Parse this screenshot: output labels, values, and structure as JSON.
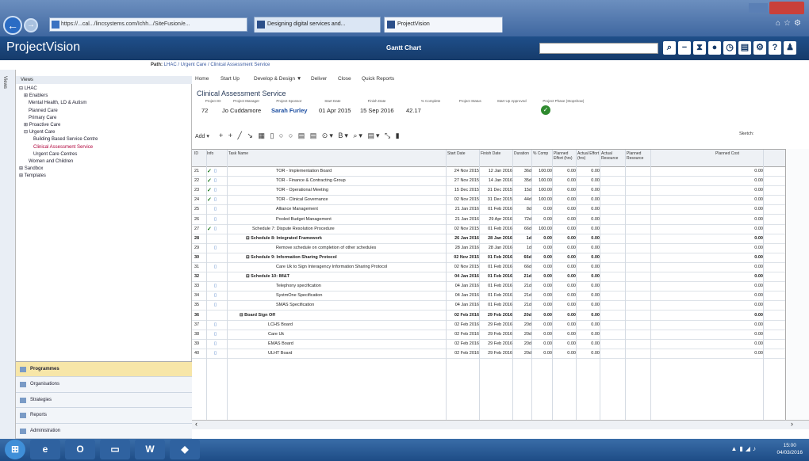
{
  "browser": {
    "address": "https://...cal.../lincsystems.com/Ichh.../SiteFusion/e...",
    "tab1": "Designing digital services and...",
    "tab2": "ProjectVision"
  },
  "app": {
    "brand": "ProjectVision",
    "view": "Gantt Chart",
    "path_label": "Path:",
    "path": "LHAC / Urgent Care / Clinical Assessment Service"
  },
  "sidebar": {
    "header": "Views",
    "tree": [
      "⊟ LHAC",
      "  ⊞ Enablers",
      "    Mental Health, LD & Autism",
      "    Planned Care",
      "    Primary Care",
      "  ⊞ Proactive Care",
      "  ⊟ Urgent Care",
      "      Building Based Service Centre",
      "      Clinical Assessment Service",
      "      Urgent Care Centres",
      "    Women and Children",
      "⊞ Sandbox",
      "⊞ Templates"
    ],
    "nav": [
      "Programmes",
      "Organisations",
      "Strategies",
      "Reports",
      "Administration"
    ],
    "strip": "Views"
  },
  "menu": {
    "home": "Home",
    "start_up": "Start Up",
    "develop": "Develop & Design ▼",
    "deliver": "Deliver",
    "close": "Close",
    "quick_reports": "Quick Reports"
  },
  "project": {
    "title": "Clinical Assessment Service",
    "headers": [
      "Project ID",
      "Project Manager",
      "Project Sponsor",
      "Start Date",
      "Finish Date",
      "% Complete",
      "Project Status",
      "Start Up Approved",
      "Project Phase (Stopshow)"
    ],
    "id": "72",
    "manager": "Jo Cuddamore",
    "sponsor": "Sarah Furley",
    "start": "01 Apr 2015",
    "finish": "15 Sep 2016",
    "complete": "42.17",
    "approved_icon": "check-circle-icon"
  },
  "toolbar": {
    "add": "Add ▾",
    "icons": "+  +  ╱  ↘  ▦  ▯  ○  ○  ▤  ▤  ⊙▾  B▾  ⌕▾  ▤▾  ⤡  ▮",
    "sketch": "Sketch:"
  },
  "grid": {
    "headers": [
      "ID",
      "Info",
      "Task Name",
      "Start Date",
      "Finish Date",
      "Duration",
      "% Comp",
      "Planned Effort (hrs)",
      "Actual Effort (hrs)",
      "Actual Resource",
      "Planned Resource",
      "Planned Cost"
    ],
    "rows": [
      {
        "id": "21",
        "chk": "✓",
        "info": "▯",
        "name": "TOR - Implementation Board",
        "start": "24 Nov 2015",
        "finish": "12 Jan 2016",
        "dur": "36d",
        "pct": "100.00",
        "pe": "0.00",
        "ae": "0.00",
        "cost": "0.00",
        "indent": 60,
        "bold": false
      },
      {
        "id": "22",
        "chk": "✓",
        "info": "▯",
        "name": "TOR - Finance & Contracting Group",
        "start": "27 Nov 2015",
        "finish": "14 Jan 2016",
        "dur": "35d",
        "pct": "100.00",
        "pe": "0.00",
        "ae": "0.00",
        "cost": "0.00",
        "indent": 60,
        "bold": false
      },
      {
        "id": "23",
        "chk": "✓",
        "info": "▯",
        "name": "TOR - Operational Meeting",
        "start": "15 Dec 2015",
        "finish": "31 Dec 2015",
        "dur": "15d",
        "pct": "100.00",
        "pe": "0.00",
        "ae": "0.00",
        "cost": "0.00",
        "indent": 60,
        "bold": false
      },
      {
        "id": "24",
        "chk": "✓",
        "info": "▯",
        "name": "TOR - Clinical Governance",
        "start": "02 Nov 2015",
        "finish": "31 Dec 2015",
        "dur": "44d",
        "pct": "100.00",
        "pe": "0.00",
        "ae": "0.00",
        "cost": "0.00",
        "indent": 60,
        "bold": false
      },
      {
        "id": "25",
        "chk": "",
        "info": "▯",
        "name": "Alliance Management",
        "start": "21 Jan 2016",
        "finish": "01 Feb 2016",
        "dur": "8d",
        "pct": "0.00",
        "pe": "0.00",
        "ae": "0.00",
        "cost": "0.00",
        "indent": 60,
        "bold": false
      },
      {
        "id": "26",
        "chk": "",
        "info": "▯",
        "name": "Pooled Budget Management",
        "start": "21 Jan 2016",
        "finish": "29 Apr 2016",
        "dur": "72d",
        "pct": "0.00",
        "pe": "0.00",
        "ae": "0.00",
        "cost": "0.00",
        "indent": 60,
        "bold": false
      },
      {
        "id": "27",
        "chk": "✓",
        "info": "▯",
        "name": "Schedule 7: Dispute Resolution Procedure",
        "start": "02 Nov 2015",
        "finish": "01 Feb 2016",
        "dur": "66d",
        "pct": "100.00",
        "pe": "0.00",
        "ae": "0.00",
        "cost": "0.00",
        "indent": 30,
        "bold": false
      },
      {
        "id": "28",
        "chk": "",
        "info": "",
        "name": "⊟  Schedule 8: Integrated Framework",
        "start": "26 Jan 2016",
        "finish": "28 Jan 2016",
        "dur": "1d",
        "pct": "0.00",
        "pe": "0.00",
        "ae": "0.00",
        "cost": "0.00",
        "indent": 22,
        "bold": true
      },
      {
        "id": "29",
        "chk": "",
        "info": "▯",
        "name": "Remove schedule on completion of other schedules",
        "start": "28 Jan 2016",
        "finish": "28 Jan 2016",
        "dur": "1d",
        "pct": "0.00",
        "pe": "0.00",
        "ae": "0.00",
        "cost": "0.00",
        "indent": 60,
        "bold": false
      },
      {
        "id": "30",
        "chk": "",
        "info": "",
        "name": "⊟  Schedule 9: Information Sharing Protocol",
        "start": "02 Nov 2015",
        "finish": "01 Feb 2016",
        "dur": "66d",
        "pct": "0.00",
        "pe": "0.00",
        "ae": "0.00",
        "cost": "0.00",
        "indent": 22,
        "bold": true
      },
      {
        "id": "31",
        "chk": "",
        "info": "▯",
        "name": "Care Uk to Sign Interagency Information Sharing Protocol",
        "start": "02 Nov 2015",
        "finish": "01 Feb 2016",
        "dur": "66d",
        "pct": "0.00",
        "pe": "0.00",
        "ae": "0.00",
        "cost": "0.00",
        "indent": 60,
        "bold": false
      },
      {
        "id": "32",
        "chk": "",
        "info": "",
        "name": "⊟  Schedule 10: IM&T",
        "start": "04 Jan 2016",
        "finish": "01 Feb 2016",
        "dur": "21d",
        "pct": "0.00",
        "pe": "0.00",
        "ae": "0.00",
        "cost": "0.00",
        "indent": 22,
        "bold": true
      },
      {
        "id": "33",
        "chk": "",
        "info": "▯",
        "name": "Telephony specification",
        "start": "04 Jan 2016",
        "finish": "01 Feb 2016",
        "dur": "21d",
        "pct": "0.00",
        "pe": "0.00",
        "ae": "0.00",
        "cost": "0.00",
        "indent": 60,
        "bold": false
      },
      {
        "id": "34",
        "chk": "",
        "info": "▯",
        "name": "SystmOne Specification",
        "start": "04 Jan 2016",
        "finish": "01 Feb 2016",
        "dur": "21d",
        "pct": "0.00",
        "pe": "0.00",
        "ae": "0.00",
        "cost": "0.00",
        "indent": 60,
        "bold": false
      },
      {
        "id": "35",
        "chk": "",
        "info": "▯",
        "name": "SMAS Specification",
        "start": "04 Jan 2016",
        "finish": "01 Feb 2016",
        "dur": "21d",
        "pct": "0.00",
        "pe": "0.00",
        "ae": "0.00",
        "cost": "0.00",
        "indent": 60,
        "bold": false
      },
      {
        "id": "36",
        "chk": "",
        "info": "",
        "name": "⊟  Board Sign Off",
        "start": "02 Feb 2016",
        "finish": "29 Feb 2016",
        "dur": "20d",
        "pct": "0.00",
        "pe": "0.00",
        "ae": "0.00",
        "cost": "0.00",
        "indent": 14,
        "bold": true
      },
      {
        "id": "37",
        "chk": "",
        "info": "▯",
        "name": "LCHS Board",
        "start": "02 Feb 2016",
        "finish": "29 Feb 2016",
        "dur": "20d",
        "pct": "0.00",
        "pe": "0.00",
        "ae": "0.00",
        "cost": "0.00",
        "indent": 50,
        "bold": false
      },
      {
        "id": "38",
        "chk": "",
        "info": "▯",
        "name": "Care Uk",
        "start": "02 Feb 2016",
        "finish": "29 Feb 2016",
        "dur": "20d",
        "pct": "0.00",
        "pe": "0.00",
        "ae": "0.00",
        "cost": "0.00",
        "indent": 50,
        "bold": false
      },
      {
        "id": "39",
        "chk": "",
        "info": "▯",
        "name": "EMAS Board",
        "start": "02 Feb 2016",
        "finish": "29 Feb 2016",
        "dur": "20d",
        "pct": "0.00",
        "pe": "0.00",
        "ae": "0.00",
        "cost": "0.00",
        "indent": 50,
        "bold": false
      },
      {
        "id": "40",
        "chk": "",
        "info": "▯",
        "name": "ULHT Board",
        "start": "02 Feb 2016",
        "finish": "29 Feb 2016",
        "dur": "20d",
        "pct": "0.00",
        "pe": "0.00",
        "ae": "0.00",
        "cost": "0.00",
        "indent": 50,
        "bold": false
      }
    ]
  },
  "taskbar": {
    "time": "15:00",
    "date": "04/03/2016"
  }
}
